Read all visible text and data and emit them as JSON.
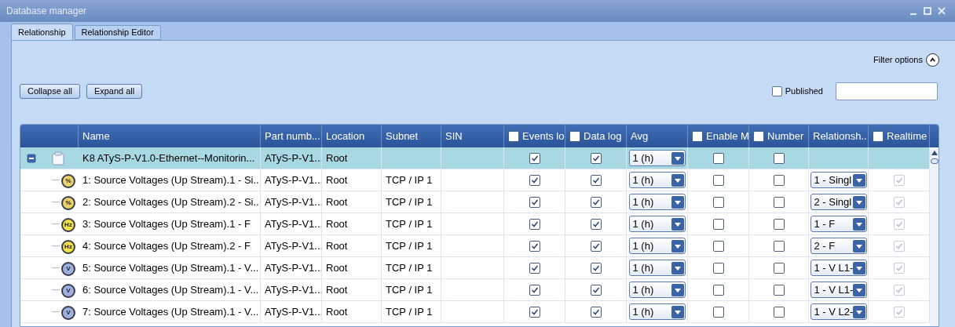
{
  "window": {
    "title": "Database manager"
  },
  "tabs": [
    {
      "label": "Relationship",
      "selected": true
    },
    {
      "label": "Relationship Editor",
      "selected": false
    }
  ],
  "filter_options": {
    "label": "Filter options",
    "expanded": true
  },
  "buttons": [
    "Collapse all",
    "Expand all"
  ],
  "published": {
    "label": "Published",
    "checked": false
  },
  "table": {
    "columns": [
      {
        "label": "Name",
        "kind": "text"
      },
      {
        "label": "Part numb...",
        "kind": "text"
      },
      {
        "label": "Location",
        "kind": "text"
      },
      {
        "label": "Subnet",
        "kind": "text"
      },
      {
        "label": "SIN",
        "kind": "text"
      },
      {
        "label": "Events lo",
        "kind": "checkbox",
        "checked": false
      },
      {
        "label": "Data log",
        "kind": "checkbox",
        "checked": false
      },
      {
        "label": "Avg",
        "kind": "text"
      },
      {
        "label": "Enable M",
        "kind": "checkbox",
        "checked": false
      },
      {
        "label": "Number",
        "kind": "checkbox",
        "checked": false
      },
      {
        "label": "Relationsh...",
        "kind": "text"
      },
      {
        "label": "Realtime",
        "kind": "checkbox",
        "checked": false
      }
    ],
    "rows": [
      {
        "kind": "device",
        "selected": true,
        "expanded": true,
        "name": "K8 ATyS-P-V1.0-Ethernet--Monitorin...",
        "part": "ATyS-P-V1...",
        "location": "Root",
        "events_log": true,
        "data_log": true,
        "avg": "1 (h)",
        "enable": false,
        "number": false
      },
      {
        "kind": "percent",
        "icon_label": "%",
        "selected": false,
        "name": "1: Source Voltages (Up Stream).1 - Si...",
        "part": "ATyS-P-V1...",
        "location": "Root",
        "subnet": "TCP / IP 1",
        "events_log": true,
        "data_log": true,
        "avg": "1 (h)",
        "enable": false,
        "number": false,
        "relationship": "1 - Singl",
        "realtime": true
      },
      {
        "kind": "percent",
        "icon_label": "%",
        "selected": false,
        "name": "2: Source Voltages (Up Stream).2 - Si...",
        "part": "ATyS-P-V1...",
        "location": "Root",
        "subnet": "TCP / IP 1",
        "events_log": true,
        "data_log": true,
        "avg": "1 (h)",
        "enable": false,
        "number": false,
        "relationship": "2 - Singl",
        "realtime": true
      },
      {
        "kind": "frequency",
        "icon_label": "Hz",
        "selected": false,
        "name": "3: Source Voltages (Up Stream).1 - F",
        "part": "ATyS-P-V1...",
        "location": "Root",
        "subnet": "TCP / IP 1",
        "events_log": true,
        "data_log": true,
        "avg": "1 (h)",
        "enable": false,
        "number": false,
        "relationship": "1 - F",
        "realtime": true
      },
      {
        "kind": "frequency",
        "icon_label": "Hz",
        "selected": false,
        "name": "4: Source Voltages (Up Stream).2 - F",
        "part": "ATyS-P-V1...",
        "location": "Root",
        "subnet": "TCP / IP 1",
        "events_log": true,
        "data_log": true,
        "avg": "1 (h)",
        "enable": false,
        "number": false,
        "relationship": "2 - F",
        "realtime": true
      },
      {
        "kind": "voltage",
        "icon_label": "V",
        "selected": false,
        "name": "5: Source Voltages (Up Stream).1 - V...",
        "part": "ATyS-P-V1...",
        "location": "Root",
        "subnet": "TCP / IP 1",
        "events_log": true,
        "data_log": true,
        "avg": "1 (h)",
        "enable": false,
        "number": false,
        "relationship": "1 - V L1-",
        "realtime": true
      },
      {
        "kind": "voltage",
        "icon_label": "V",
        "selected": false,
        "name": "6: Source Voltages (Up Stream).1 - V...",
        "part": "ATyS-P-V1...",
        "location": "Root",
        "subnet": "TCP / IP 1",
        "events_log": true,
        "data_log": true,
        "avg": "1 (h)",
        "enable": false,
        "number": false,
        "relationship": "1 - V L1-",
        "realtime": true
      },
      {
        "kind": "voltage",
        "icon_label": "V",
        "selected": false,
        "name": "7: Source Voltages (Up Stream).1 - V...",
        "part": "ATyS-P-V1...",
        "location": "Root",
        "subnet": "TCP / IP 1",
        "events_log": true,
        "data_log": true,
        "avg": "1 (h)",
        "enable": false,
        "number": false,
        "relationship": "1 - V L2-",
        "realtime": true
      }
    ]
  }
}
